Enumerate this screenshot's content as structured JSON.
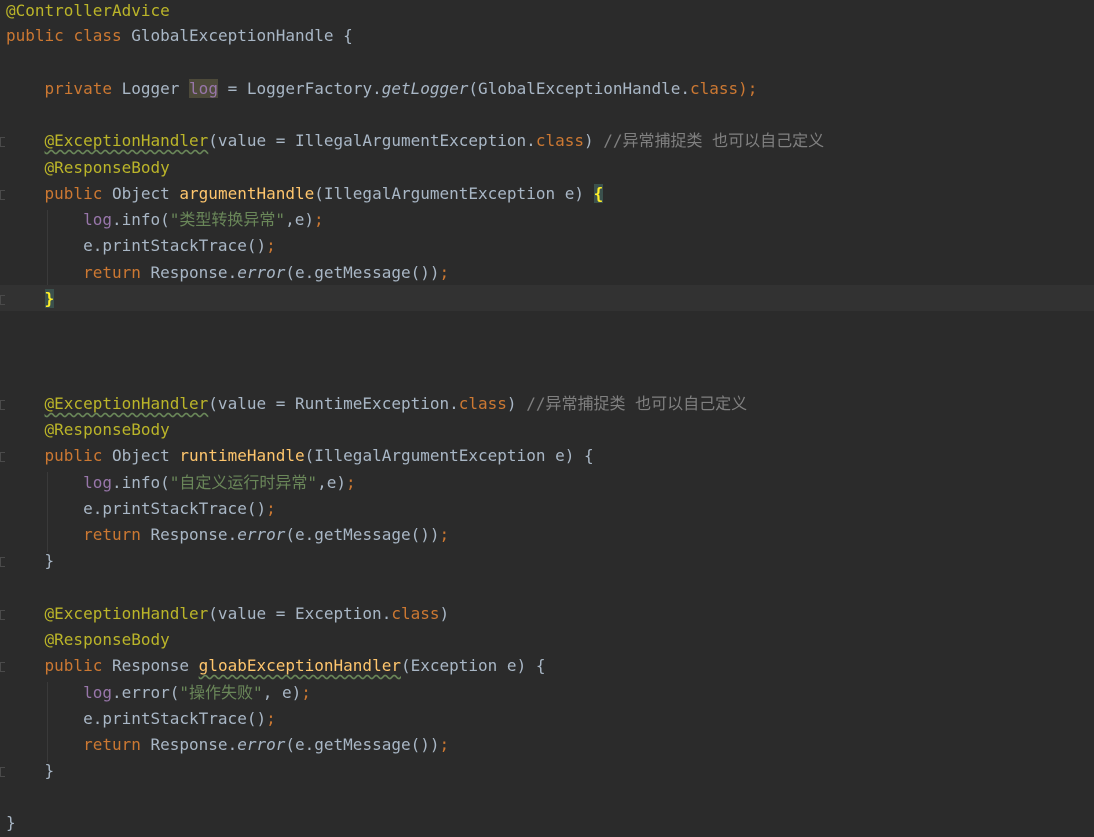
{
  "editor": {
    "colors": {
      "background": "#2b2b2b",
      "keyword": "#cc7832",
      "annotation": "#bbb529",
      "method": "#ffc66d",
      "field": "#9876aa",
      "string": "#6a8759",
      "comment": "#808080",
      "text": "#a9b7c6"
    },
    "class_decl": {
      "annotation": "@ControllerAdvice",
      "kw_public": "public",
      "kw_class": "class",
      "name": "GlobalExceptionHandle",
      "open": " {",
      "close": "}"
    },
    "field_decl": {
      "kw_private": "private",
      "type": "Logger",
      "name": "log",
      "assign": " = LoggerFactory.",
      "call": "getLogger",
      "arg": "(GlobalExceptionHandle.",
      "kw_class": "class",
      "end": ");"
    },
    "methods": [
      {
        "annotation": "@ExceptionHandler",
        "ann_args_pre": "(value = IllegalArgumentException.",
        "ann_kw_class": "class",
        "ann_args_post": ") ",
        "comment": "//异常捕捉类 也可以自己定义",
        "response_body": "@ResponseBody",
        "kw_public": "public",
        "return_type": "Object",
        "name": "argumentHandle",
        "params": "(IllegalArgumentException e) ",
        "open": "{",
        "log_call": "info",
        "log_msg": "\"类型转换异常\"",
        "log_tail": ",e",
        "print_stack": "e.printStackTrace",
        "kw_return": "return",
        "response": "Response.",
        "error_call": "error",
        "error_arg": "(e.getMessage())",
        "close": "}"
      },
      {
        "annotation": "@ExceptionHandler",
        "ann_args_pre": "(value = RuntimeException.",
        "ann_kw_class": "class",
        "ann_args_post": ") ",
        "comment": "//异常捕捉类 也可以自己定义",
        "response_body": "@ResponseBody",
        "kw_public": "public",
        "return_type": "Object",
        "name": "runtimeHandle",
        "params": "(IllegalArgumentException e) ",
        "open": "{",
        "log_call": "info",
        "log_msg": "\"自定义运行时异常\"",
        "log_tail": ",e",
        "print_stack": "e.printStackTrace",
        "kw_return": "return",
        "response": "Response.",
        "error_call": "error",
        "error_arg": "(e.getMessage())",
        "close": "}"
      },
      {
        "annotation": "@ExceptionHandler",
        "ann_args_pre": "(value = Exception.",
        "ann_kw_class": "class",
        "ann_args_post": ")",
        "comment": "",
        "response_body": "@ResponseBody",
        "kw_public": "public",
        "return_type": "Response",
        "name": "gloabExceptionHandler",
        "params": "(Exception e) ",
        "open": "{",
        "log_call": "error",
        "log_msg": "\"操作失败\"",
        "log_tail": ", e",
        "print_stack": "e.printStackTrace",
        "kw_return": "return",
        "response": "Response.",
        "error_call": "error",
        "error_arg": "(e.getMessage())",
        "close": "}"
      }
    ]
  }
}
